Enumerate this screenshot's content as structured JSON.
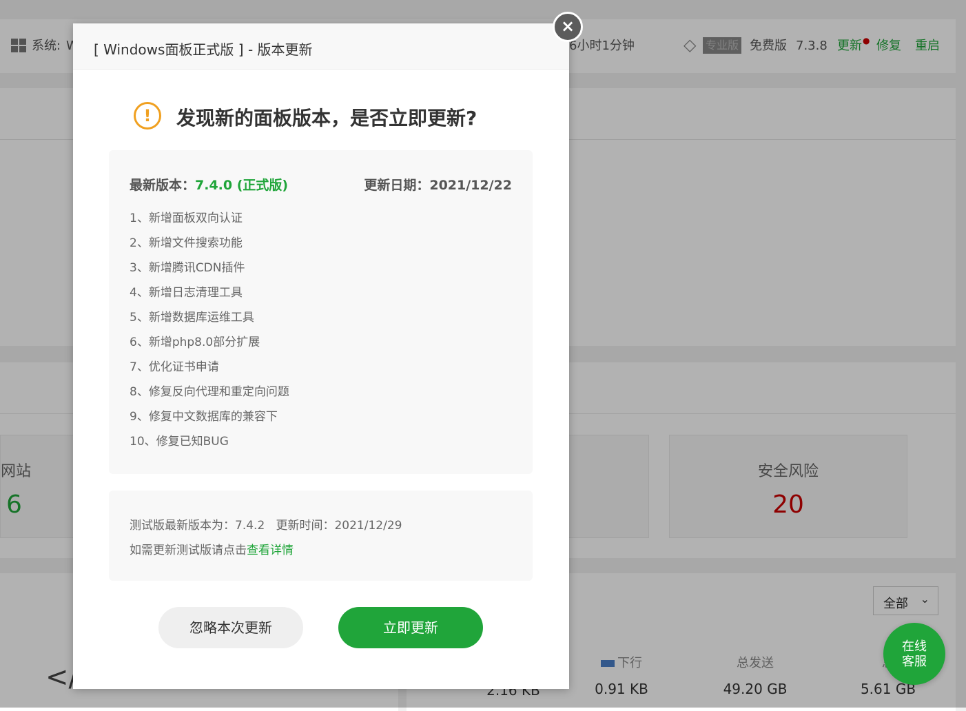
{
  "topbar": {
    "system_label": "系统:",
    "system_value": "W",
    "uptime": "6小时1分钟",
    "pro_badge": "专业版",
    "free_label": "免费版",
    "version": "7.3.8",
    "update_link": "更新",
    "repair_link": "修复",
    "restart_link": "重启"
  },
  "overview": {
    "websites_label": "网站",
    "websites_value": "6",
    "security_label": "安全风险",
    "security_value": "20"
  },
  "network": {
    "filter_selected": "全部",
    "downstream_label": "下行",
    "downstream_value": "0.91 KB",
    "total_sent_label": "总发送",
    "total_sent_value": "49.20 GB",
    "total_received_label_partial": "总",
    "total_received_value": "5.61 GB",
    "upstream_value_partial": "2.16 KB"
  },
  "modal": {
    "title": "[ Windows面板正式版 ] - 版本更新",
    "close": "×",
    "headline": "发现新的面板版本，是否立即更新?",
    "latest_label": "最新版本：",
    "latest_version": "7.4.0 (正式版)",
    "date_label": "更新日期：",
    "date_value": "2021/12/22",
    "notes": [
      "1、新增面板双向认证",
      "2、新增文件搜索功能",
      "3、新增腾讯CDN插件",
      "4、新增日志清理工具",
      "5、新增数据库运维工具",
      "6、新增php8.0部分扩展",
      "7、优化证书申请",
      "8、修复反向代理和重定向问题",
      "9、修复中文数据库的兼容下",
      "10、修复已知BUG"
    ],
    "beta_line1": "测试版最新版本为：7.4.2   更新时间：2021/12/29",
    "beta_line2_prefix": "如需更新测试版请点击",
    "beta_link": "查看详情",
    "ignore_button": "忽略本次更新",
    "update_button": "立即更新"
  },
  "chat": {
    "line1": "在线",
    "line2": "客服"
  },
  "colors": {
    "green": "#20a53a",
    "red": "#cc0000",
    "warning": "#f0a020"
  }
}
